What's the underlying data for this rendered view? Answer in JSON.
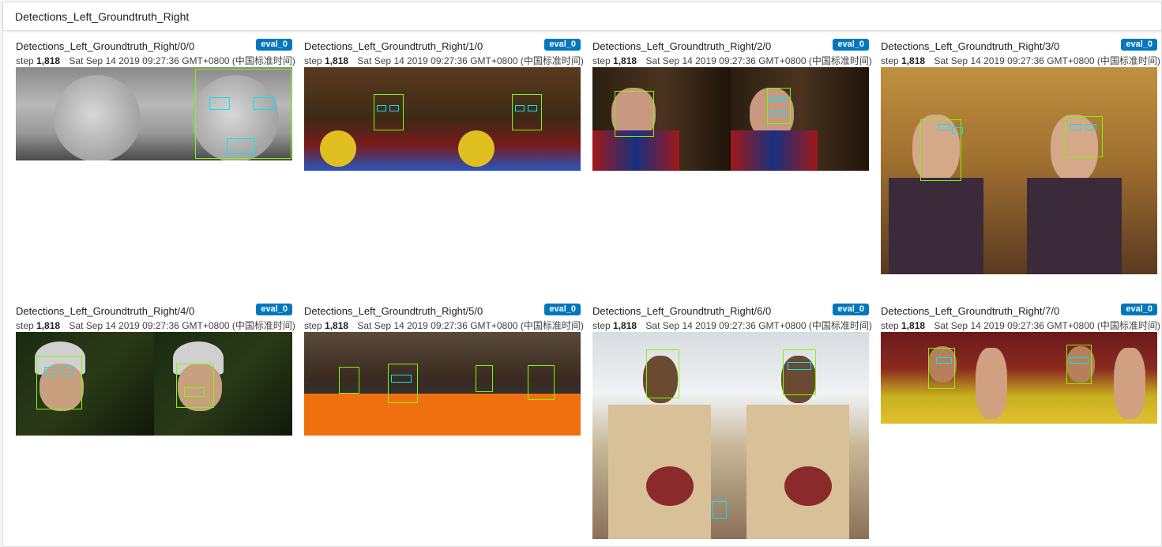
{
  "panel": {
    "title": "Detections_Left_Groundtruth_Right"
  },
  "cards": [
    {
      "title": "Detections_Left_Groundtruth_Right/0/0",
      "run": "eval_0",
      "step_label": "step",
      "step": "1,818",
      "timestamp": "Sat Sep 14 2019 09:27:36 GMT+0800 (中国标准时间)"
    },
    {
      "title": "Detections_Left_Groundtruth_Right/1/0",
      "run": "eval_0",
      "step_label": "step",
      "step": "1,818",
      "timestamp": "Sat Sep 14 2019 09:27:36 GMT+0800 (中国标准时间)"
    },
    {
      "title": "Detections_Left_Groundtruth_Right/2/0",
      "run": "eval_0",
      "step_label": "step",
      "step": "1,818",
      "timestamp": "Sat Sep 14 2019 09:27:36 GMT+0800 (中国标准时间)"
    },
    {
      "title": "Detections_Left_Groundtruth_Right/3/0",
      "run": "eval_0",
      "step_label": "step",
      "step": "1,818",
      "timestamp": "Sat Sep 14 2019 09:27:36 GMT+0800 (中国标准时间)"
    },
    {
      "title": "Detections_Left_Groundtruth_Right/4/0",
      "run": "eval_0",
      "step_label": "step",
      "step": "1,818",
      "timestamp": "Sat Sep 14 2019 09:27:36 GMT+0800 (中国标准时间)"
    },
    {
      "title": "Detections_Left_Groundtruth_Right/5/0",
      "run": "eval_0",
      "step_label": "step",
      "step": "1,818",
      "timestamp": "Sat Sep 14 2019 09:27:36 GMT+0800 (中国标准时间)"
    },
    {
      "title": "Detections_Left_Groundtruth_Right/6/0",
      "run": "eval_0",
      "step_label": "step",
      "step": "1,818",
      "timestamp": "Sat Sep 14 2019 09:27:36 GMT+0800 (中国标准时间)"
    },
    {
      "title": "Detections_Left_Groundtruth_Right/7/0",
      "run": "eval_0",
      "step_label": "step",
      "step": "1,818",
      "timestamp": "Sat Sep 14 2019 09:27:36 GMT+0800 (中国标准时间)"
    }
  ],
  "colors": {
    "badge": "#0277bd",
    "groundtruth_box": "#7cfc00",
    "detection_box": "#00e5ff"
  }
}
